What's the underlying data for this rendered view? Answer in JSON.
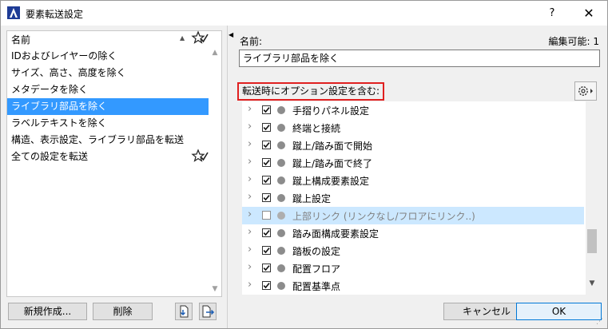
{
  "window": {
    "title": "要素転送設定",
    "help": "?",
    "close": "✕"
  },
  "left": {
    "header": "名前",
    "items": [
      {
        "label": "IDおよびレイヤーの除く",
        "selected": false,
        "starred": false
      },
      {
        "label": "サイズ、高さ、高度を除く",
        "selected": false,
        "starred": false
      },
      {
        "label": "メタデータを除く",
        "selected": false,
        "starred": false
      },
      {
        "label": "ライブラリ部品を除く",
        "selected": true,
        "starred": false
      },
      {
        "label": "ラベルテキストを除く",
        "selected": false,
        "starred": false
      },
      {
        "label": "構造、表示設定、ライブラリ部品を転送",
        "selected": false,
        "starred": false
      },
      {
        "label": "全ての設定を転送",
        "selected": false,
        "starred": true
      }
    ],
    "new_button": "新規作成...",
    "delete_button": "削除"
  },
  "right": {
    "name_label": "名前:",
    "edit_label": "編集可能: 1",
    "name_value": "ライブラリ部品を除く",
    "options_label": "転送時にオプション設定を含む:",
    "tree": [
      {
        "label": "手摺りパネル設定",
        "checked": true,
        "disabled": false
      },
      {
        "label": "終端と接続",
        "checked": true,
        "disabled": false
      },
      {
        "label": "蹴上/踏み面で開始",
        "checked": true,
        "disabled": false
      },
      {
        "label": "蹴上/踏み面で終了",
        "checked": true,
        "disabled": false
      },
      {
        "label": "蹴上構成要素設定",
        "checked": true,
        "disabled": false
      },
      {
        "label": "蹴上設定",
        "checked": true,
        "disabled": false
      },
      {
        "label": "上部リンク (リンクなし/フロアにリンク..)",
        "checked": false,
        "disabled": true
      },
      {
        "label": "踏み面構成要素設定",
        "checked": true,
        "disabled": false
      },
      {
        "label": "踏板の設定",
        "checked": true,
        "disabled": false
      },
      {
        "label": "配置フロア",
        "checked": true,
        "disabled": false
      },
      {
        "label": "配置基準点",
        "checked": true,
        "disabled": false
      }
    ]
  },
  "footer": {
    "cancel": "キャンセル",
    "ok": "OK"
  }
}
